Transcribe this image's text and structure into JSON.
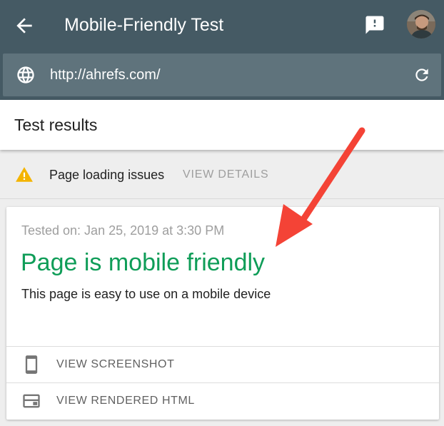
{
  "appbar": {
    "title": "Mobile-Friendly Test",
    "back_icon": "arrow-back-icon",
    "feedback_icon": "feedback-icon",
    "avatar_icon": "user-avatar"
  },
  "urlbar": {
    "url": "http://ahrefs.com/",
    "globe_icon": "globe-icon",
    "refresh_icon": "refresh-icon"
  },
  "results": {
    "title": "Test results"
  },
  "issues": {
    "icon": "warning-icon",
    "text": "Page loading issues",
    "action": "VIEW DETAILS"
  },
  "card": {
    "tested_on": "Tested on: Jan 25, 2019 at 3:30 PM",
    "verdict": "Page is mobile friendly",
    "description": "This page is easy to use on a mobile device",
    "actions": [
      {
        "icon": "smartphone-icon",
        "label": "VIEW SCREENSHOT"
      },
      {
        "icon": "web-window-icon",
        "label": "VIEW RENDERED HTML"
      }
    ]
  },
  "colors": {
    "appbar": "#455a64",
    "urlbar": "#5f737c",
    "verdict_green": "#0f9d58",
    "warning_yellow": "#f4b400",
    "annotation_red": "#f44336"
  }
}
